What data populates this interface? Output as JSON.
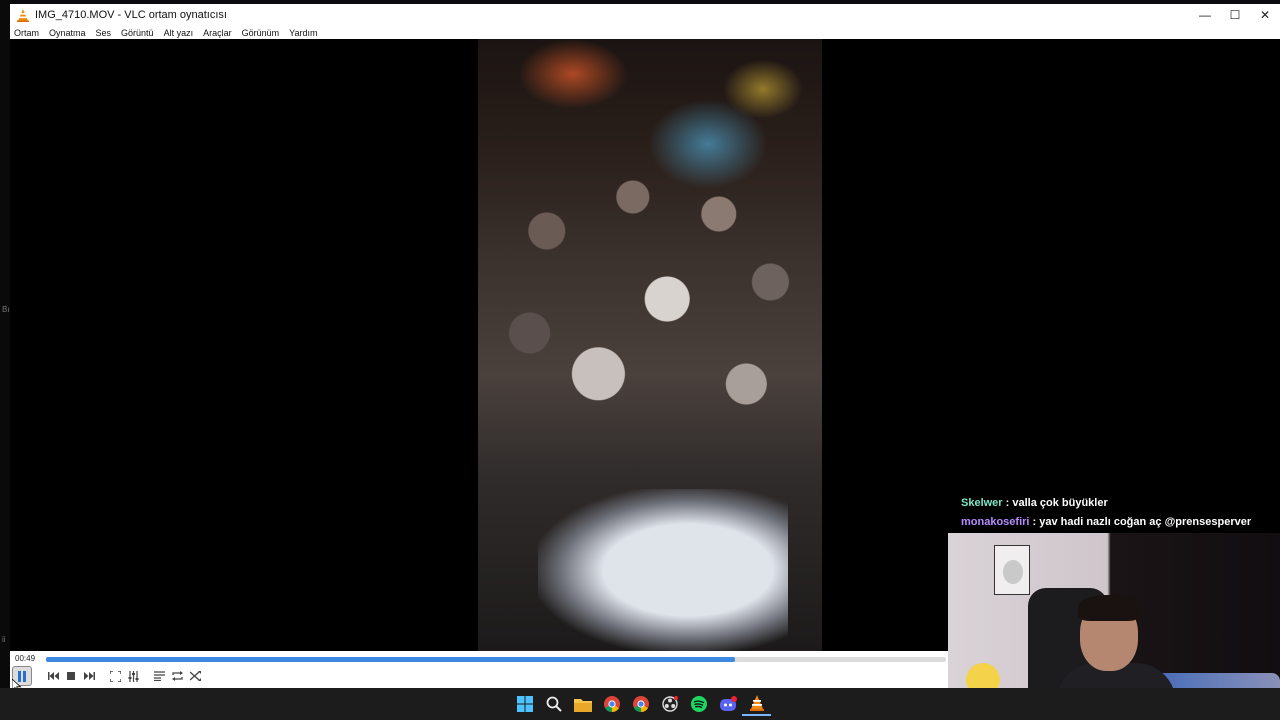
{
  "window": {
    "title": "IMG_4710.MOV - VLC ortam oynatıcısı",
    "minimize_glyph": "—",
    "maximize_glyph": "☐",
    "close_glyph": "✕"
  },
  "menu": {
    "items": [
      {
        "label": "Ortam"
      },
      {
        "label": "Oynatma"
      },
      {
        "label": "Ses"
      },
      {
        "label": "Görüntü"
      },
      {
        "label": "Alt yazı"
      },
      {
        "label": "Araçlar"
      },
      {
        "label": "Görünüm"
      },
      {
        "label": "Yardım"
      }
    ]
  },
  "player": {
    "elapsed_time": "00:49",
    "progress_fraction": 0.765,
    "accent_color": "#3d88e0"
  },
  "controls": {
    "icons": [
      "pause-icon",
      "previous-icon",
      "stop-icon",
      "next-icon",
      "fullscreen-icon",
      "extended-settings-icon",
      "playlist-icon",
      "loop-icon",
      "shuffle-icon"
    ]
  },
  "chat": {
    "messages": [
      {
        "user": "Skelwer",
        "separator": " : ",
        "text": "valla çok büyükler"
      },
      {
        "user": "monakosefiri",
        "separator": " : ",
        "text": "yav hadi nazlı coğan aç @prensesperver"
      }
    ]
  },
  "left_edge": {
    "marks": [
      "Bı",
      "ii"
    ]
  },
  "taskbar": {
    "icons": [
      "windows-start-icon",
      "search-icon",
      "file-explorer-icon",
      "chrome-icon",
      "chrome-icon-2",
      "obs-icon",
      "spotify-icon",
      "discord-icon",
      "vlc-icon"
    ]
  }
}
